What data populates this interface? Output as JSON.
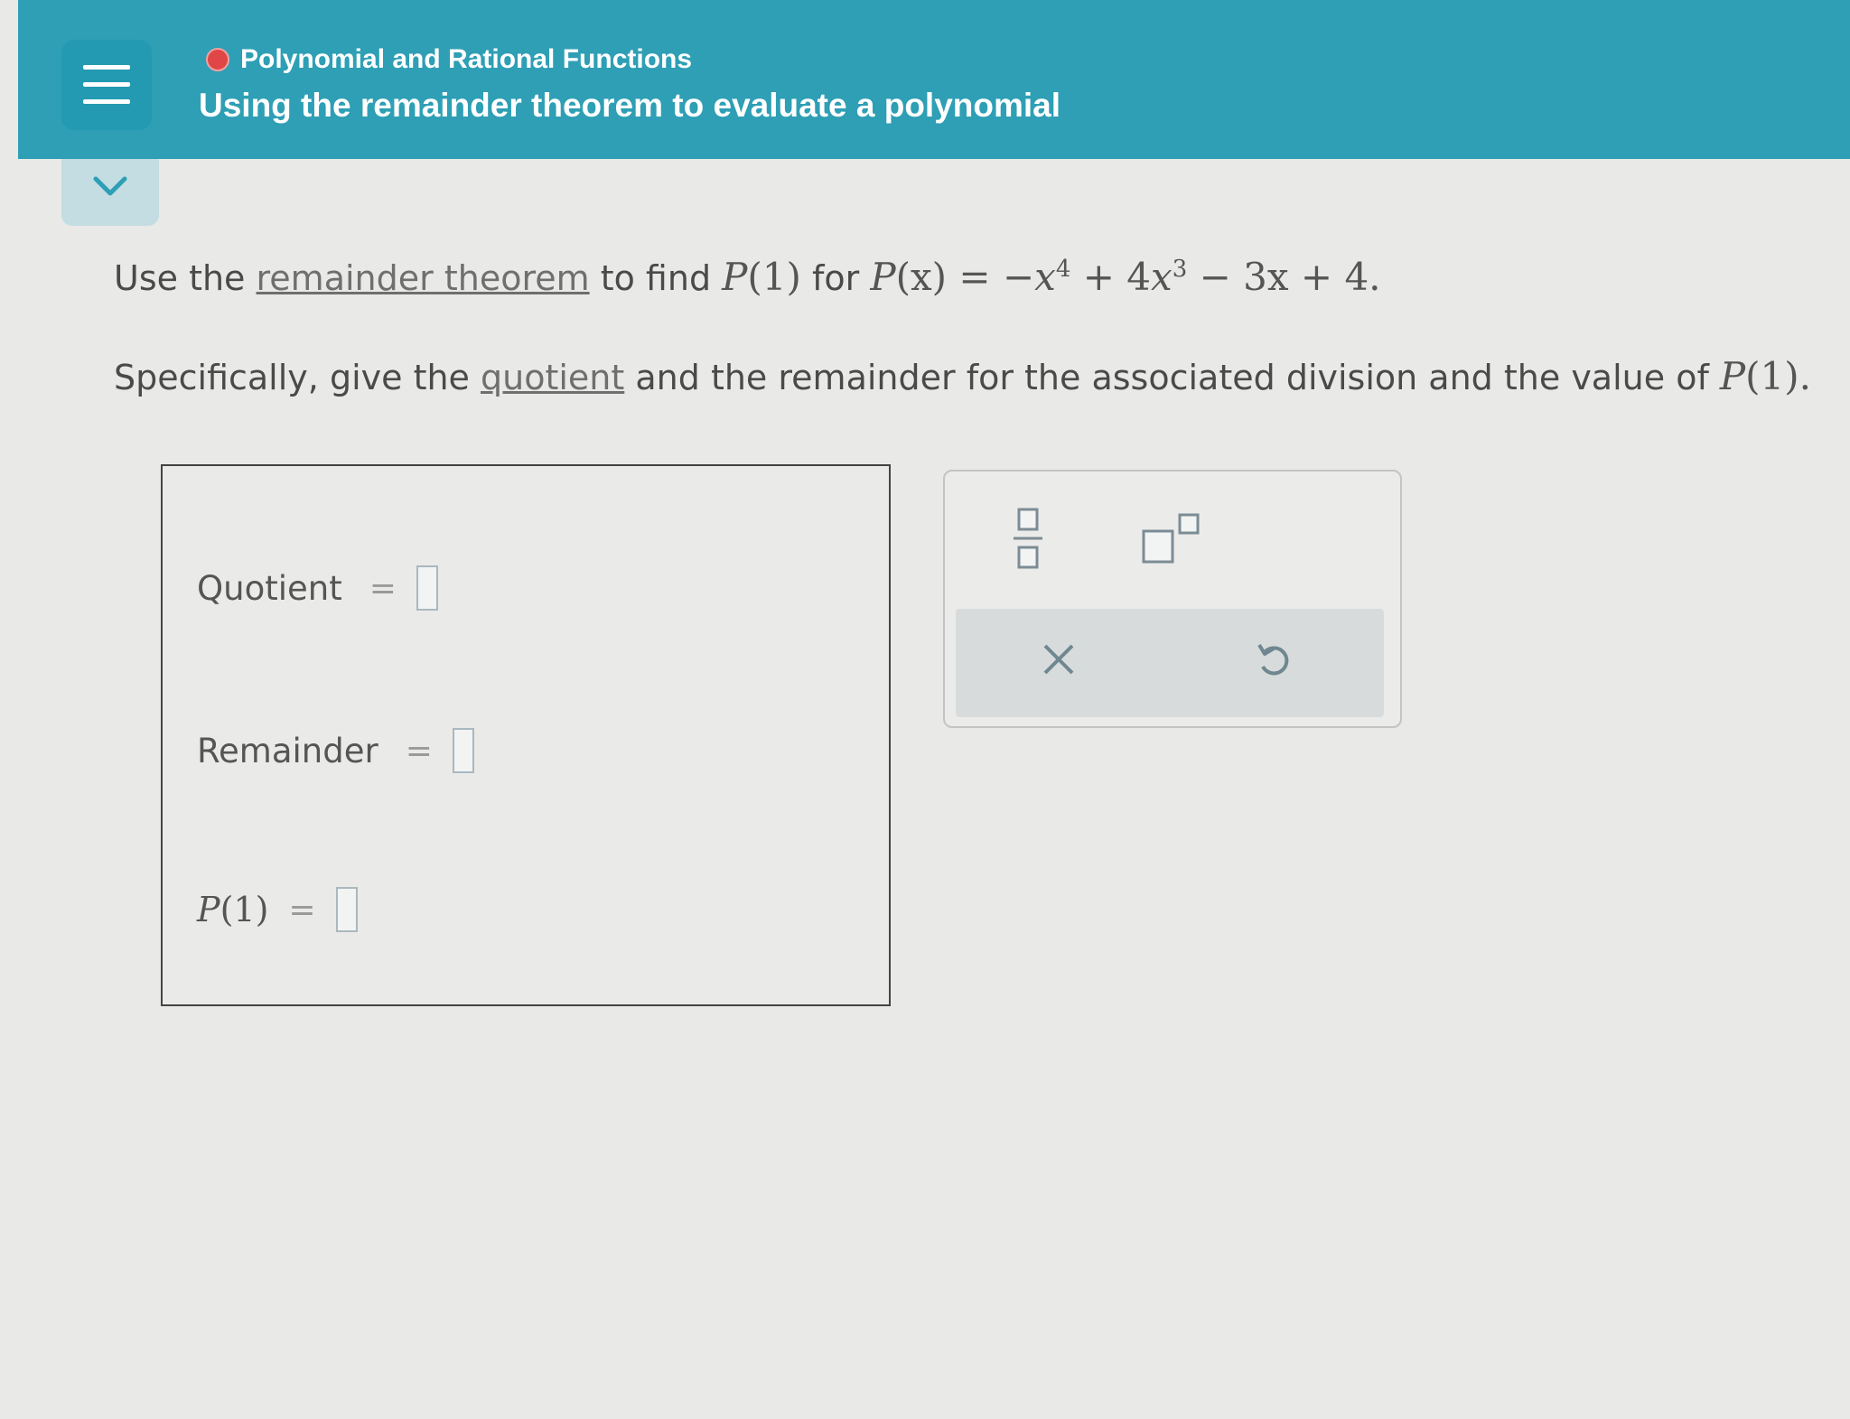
{
  "header": {
    "breadcrumb": "Polynomial and Rational Functions",
    "title": "Using the remainder theorem to evaluate a polynomial",
    "status_color": "#e04646",
    "bar_color": "#2e9fb5"
  },
  "question": {
    "line1_prefix": "Use the ",
    "line1_link": "remainder theorem",
    "line1_mid": " to find ",
    "line1_p1": "(1)",
    "line1_for": " for ",
    "line1_px": "(x)",
    "line1_eq": " = −",
    "exp4": "4",
    "term2": " + 4",
    "exp3": "3",
    "term3": " − 3x + 4.",
    "var_P": "P",
    "var_x": "x",
    "line2_prefix": "Specifically, give the ",
    "line2_link": "quotient",
    "line2_suffix": " and the remainder for the associated division and the value of ",
    "line2_end": "(1)."
  },
  "answers": {
    "quotient_label": "Quotient",
    "remainder_label": "Remainder",
    "p1_var": "P",
    "p1_arg": "(1)",
    "equals": "="
  },
  "toolbar": {
    "icons": [
      "fraction-icon",
      "exponent-icon",
      "clear-icon",
      "undo-icon"
    ]
  }
}
